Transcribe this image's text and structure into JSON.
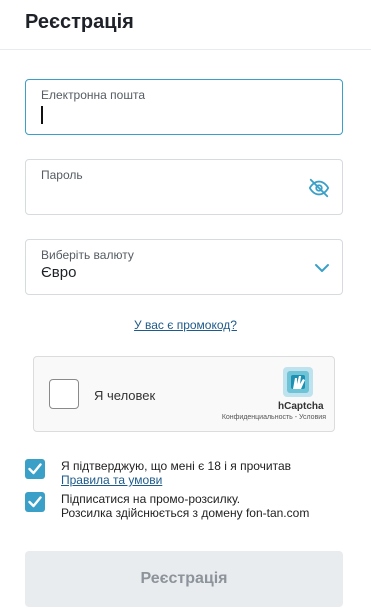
{
  "header": {
    "title": "Реєстрація"
  },
  "form": {
    "email": {
      "label": "Електронна пошта",
      "value": ""
    },
    "password": {
      "label": "Пароль",
      "value": ""
    },
    "currency": {
      "label": "Виберіть валюту",
      "value": "Євро"
    },
    "promo_link": "У вас є промокод?"
  },
  "captcha": {
    "label": "Я человек",
    "brand": "hCaptcha",
    "links": "Конфиденциальность - Условия"
  },
  "agreements": [
    {
      "text": "Я підтверджую, що мені є 18 і я прочитав",
      "link": "Правила та умови",
      "checked": true
    },
    {
      "line1": "Підписатися на промо-розсилку.",
      "line2": "Розсилка здійснюється з домену fon-tan.com",
      "checked": true
    }
  ],
  "submit": {
    "label": "Реєстрація",
    "disabled": true
  },
  "colors": {
    "accent": "#3aa0c8",
    "link": "#1e5a8a",
    "button_bg": "#e9ecef",
    "button_text": "#8c939a"
  }
}
